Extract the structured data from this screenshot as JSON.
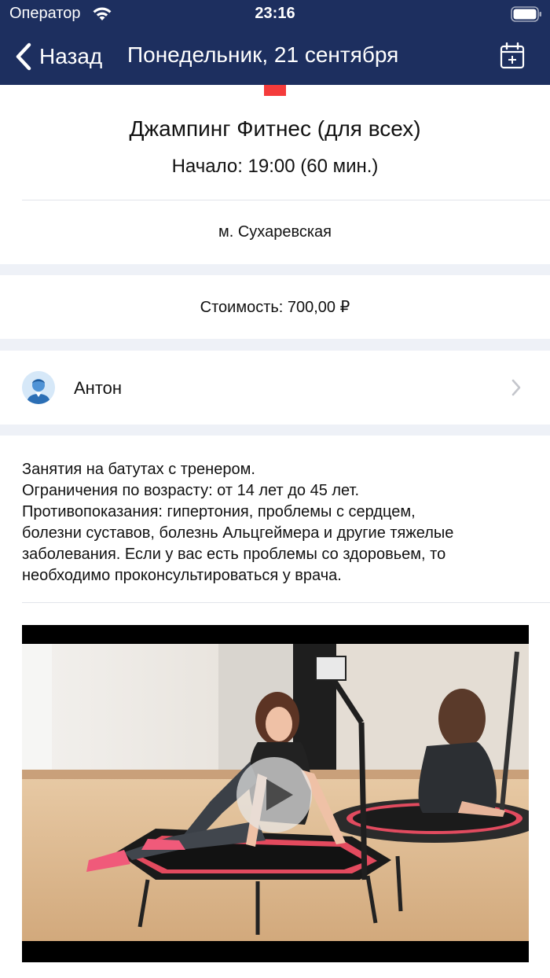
{
  "status_bar": {
    "carrier": "Оператор",
    "time": "23:16",
    "wifi_icon": "wifi-icon",
    "battery_icon": "battery-icon"
  },
  "nav": {
    "back_label": "Назад",
    "title": "Понедельник, 21 сентября",
    "back_icon": "chevron-left-icon",
    "calendar_icon": "calendar-add-icon"
  },
  "event": {
    "title": "Джампинг Фитнес (для всех)",
    "start": "Начало: 19:00 (60 мин.)",
    "metro": "м. Сухаревская",
    "price": "Стоимость: 700,00 ₽"
  },
  "trainer": {
    "name": "Антон",
    "avatar_icon": "avatar-icon",
    "chevron_icon": "chevron-right-icon"
  },
  "description": {
    "lines": [
      "Занятия на батутах с тренером.",
      "Ограничения по возрасту: от 14 лет до 45 лет.",
      "Противопоказания: гипертония, проблемы с сердцем,",
      "болезни суставов, болезнь Альцгеймера и другие тяжелые",
      "заболевания. Если у вас есть проблемы со здоровьем, то",
      "необходимо проконсультироваться у врача."
    ]
  },
  "video": {
    "play_icon": "play-icon"
  },
  "colors": {
    "header_bg": "#1d2f5f",
    "accent": "#f43b3b",
    "section_gap": "#eef1f7",
    "divider": "#e2e4ea"
  }
}
